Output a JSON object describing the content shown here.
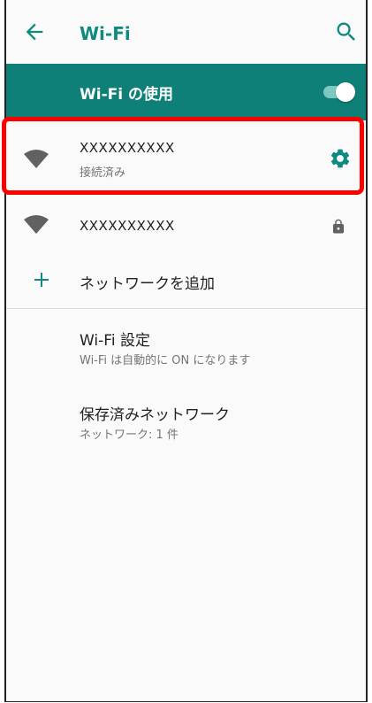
{
  "header": {
    "title": "Wi-Fi",
    "back_icon": "arrow-left-icon",
    "search_icon": "search-icon"
  },
  "master_switch": {
    "label": "Wi-Fi の使用",
    "state": "on",
    "color": "#0e8077"
  },
  "networks": [
    {
      "name": "XXXXXXXXXX",
      "status": "接続済み",
      "action_icon": "gear-icon",
      "highlighted": true
    },
    {
      "name": "XXXXXXXXXX",
      "action_icon": "lock-icon"
    }
  ],
  "add_network": {
    "label": "ネットワークを追加",
    "icon": "plus-icon"
  },
  "settings": [
    {
      "title": "Wi-Fi 設定",
      "subtitle": "Wi-Fi は自動的に ON になります"
    },
    {
      "title": "保存済みネットワーク",
      "subtitle": "ネットワーク: 1 件"
    }
  ],
  "colors": {
    "accent": "#0e8a80",
    "highlight": "#ff0000"
  }
}
